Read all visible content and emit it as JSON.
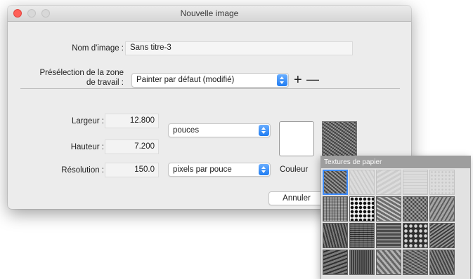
{
  "window": {
    "title": "Nouvelle image"
  },
  "image_name": {
    "label": "Nom d'image :",
    "value": "Sans titre-3"
  },
  "preset": {
    "label_line1": "Présélection de la zone",
    "label_line2": "de travail :",
    "value": "Painter par défaut (modifié)",
    "add_glyph": "+",
    "remove_glyph": "—"
  },
  "dimensions": {
    "width_label": "Largeur :",
    "width_value": "12.800",
    "height_label": "Hauteur :",
    "height_value": "7.200",
    "units": "pouces"
  },
  "resolution": {
    "label": "Résolution :",
    "value": "150.0",
    "units": "pixels par pouce"
  },
  "color": {
    "label": "Couleur",
    "value": "#ffffff"
  },
  "buttons": {
    "cancel": "Annuler"
  },
  "texture_popup": {
    "title": "Textures de papier",
    "selected_index": 0,
    "texture_count": 20
  }
}
